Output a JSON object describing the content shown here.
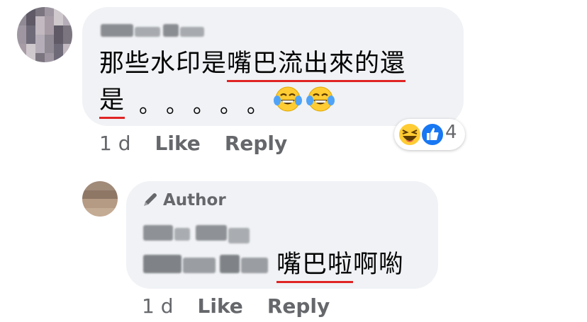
{
  "comment": {
    "text_line1_plain": "那些水印是",
    "text_line1_marked": "嘴巴流出來的還",
    "text_line2_marked": "是",
    "dots": [
      "。",
      "。",
      "。",
      "。",
      "。"
    ],
    "emoji_names": [
      "tears-of-joy-icon",
      "tears-of-joy-icon"
    ],
    "time": "1 d",
    "like_label": "Like",
    "reply_label": "Reply",
    "reactions": {
      "icons": [
        "laughing-reaction-icon",
        "like-reaction-icon"
      ],
      "count": "4"
    }
  },
  "reply": {
    "author_badge": "Author",
    "text_marked": "嘴巴啦",
    "text_plain": "啊喲",
    "time": "1 d",
    "like_label": "Like",
    "reply_label": "Reply"
  },
  "colors": {
    "bubble": "#f0f2f5",
    "meta_text": "#65676b",
    "underline": "#e02424",
    "like_blue": "#1877f2",
    "emoji_yellow": "#ffcc33"
  }
}
